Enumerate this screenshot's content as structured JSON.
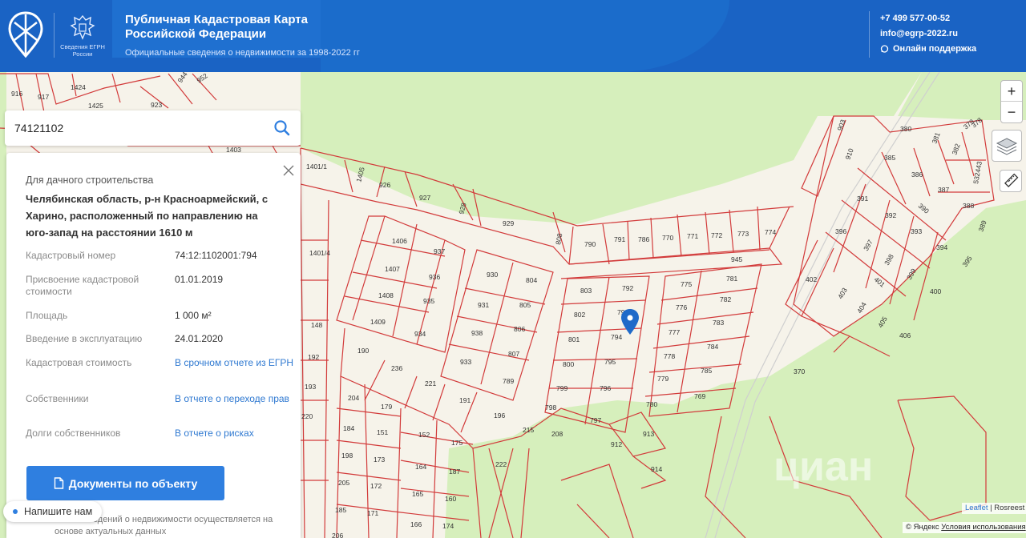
{
  "header": {
    "logo_caption": "Сведения ЕГРН России",
    "title": "Публичная Кадастровая Карта Российской Федерации",
    "subtitle": "Официальные сведения о недвижимости за 1998-2022 гг",
    "phone": "+7 499 577-00-52",
    "email": "info@egrp-2022.ru",
    "support": "Онлайн поддержка"
  },
  "search": {
    "value": "74121102"
  },
  "panel": {
    "category": "Для дачного строительства",
    "address": "Челябинская область, р-н Красноармейский, с Харино, расположенный по направлению на юго-запад на расстоянии 1610 м",
    "rows": [
      {
        "label": "Кадастровый номер",
        "value": "74:12:1102001:794"
      },
      {
        "label": "Присвоение кадастровой стоимости",
        "value": "01.01.2019"
      },
      {
        "label": "Площадь",
        "value": "1 000 м²"
      },
      {
        "label": "Введение в эксплуатацию",
        "value": "24.01.2020"
      },
      {
        "label": "Кадастровая стоимость",
        "value": "В срочном отчете из ЕГРН"
      },
      {
        "label": "Собственники",
        "value": "В отчете о переходе прав"
      },
      {
        "label": "Долги собственников",
        "value": "В отчете о рисках"
      }
    ],
    "docs_button": "Документы по объекту",
    "footer_note": "...ение сведений о недвижимости осуществляется на основе актуальных данных"
  },
  "chat": {
    "label": "Напишите нам"
  },
  "map": {
    "zoom_in": "+",
    "zoom_out": "−",
    "attribution_leaflet": "Leaflet",
    "attribution_rest": " | Rosreest",
    "yandex_attr": "© Яндекс ",
    "yandex_terms": "Условия использования",
    "watermark": "циан",
    "parcel_color": "#d23a3a",
    "green_color": "#d6efbc",
    "land_color": "#f6f3ea"
  }
}
